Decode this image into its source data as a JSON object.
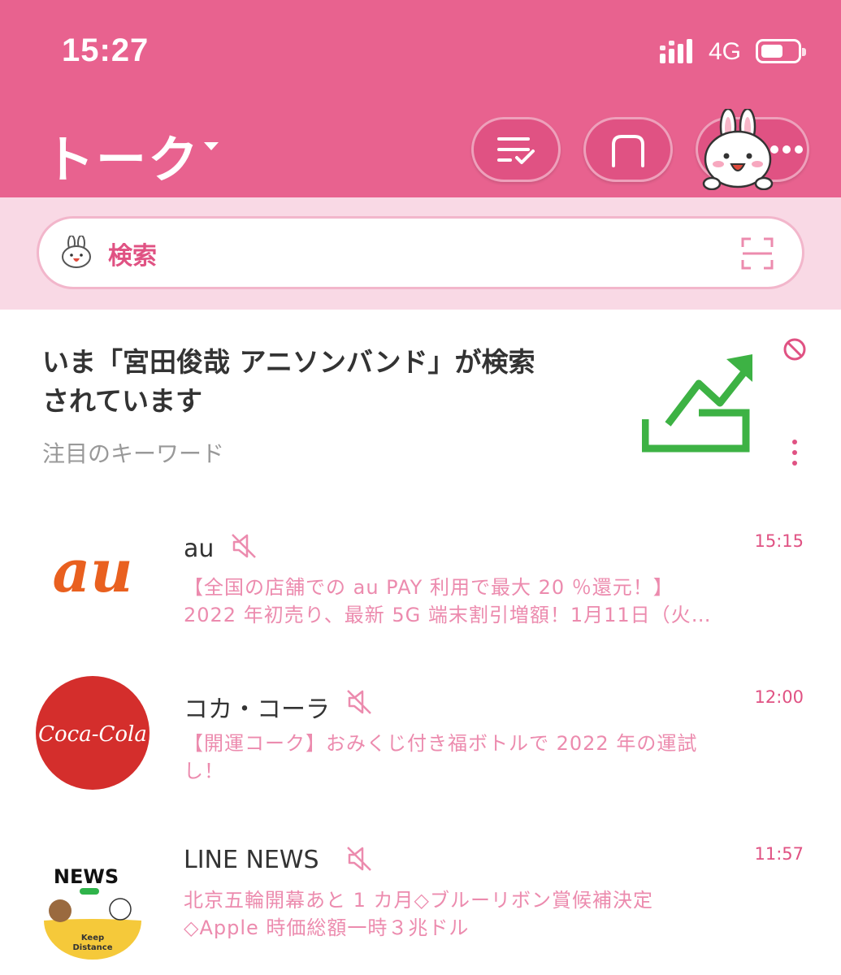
{
  "status_bar": {
    "time": "15:27",
    "network": "4G"
  },
  "header": {
    "title": "トーク"
  },
  "search": {
    "placeholder": "検索"
  },
  "keyword_card": {
    "title_line1": "いま「宮田俊哉 アニソンバンド」が検索",
    "title_line2": "されています",
    "subtitle": "注目のキーワード"
  },
  "chats": [
    {
      "name": "au",
      "time": "15:15",
      "preview_line1": "【全国の店舗での au PAY 利用で最大 20 ％還元！】",
      "preview_line2": "2022 年初売り、最新 5G 端末割引増額！1月11日（火…",
      "logo_text": "au"
    },
    {
      "name": "コカ・コーラ",
      "time": "12:00",
      "preview_line1": "【開運コーク】おみくじ付き福ボトルで 2022 年の運試",
      "preview_line2": "し！",
      "logo_text": "Coca-Cola"
    },
    {
      "name": "LINE NEWS",
      "time": "11:57",
      "preview_line1": "北京五輪開幕あと 1 カ月◇ブルーリボン賞候補決定",
      "preview_line2": "◇Apple 時価総額一時３兆ドル",
      "logo_text": "NEWS",
      "logo_sub": "Keep Distance"
    }
  ],
  "colors": {
    "header": "#e8628f",
    "accent": "#e05283",
    "preview": "#ec8bae",
    "trend": "#3db244"
  }
}
